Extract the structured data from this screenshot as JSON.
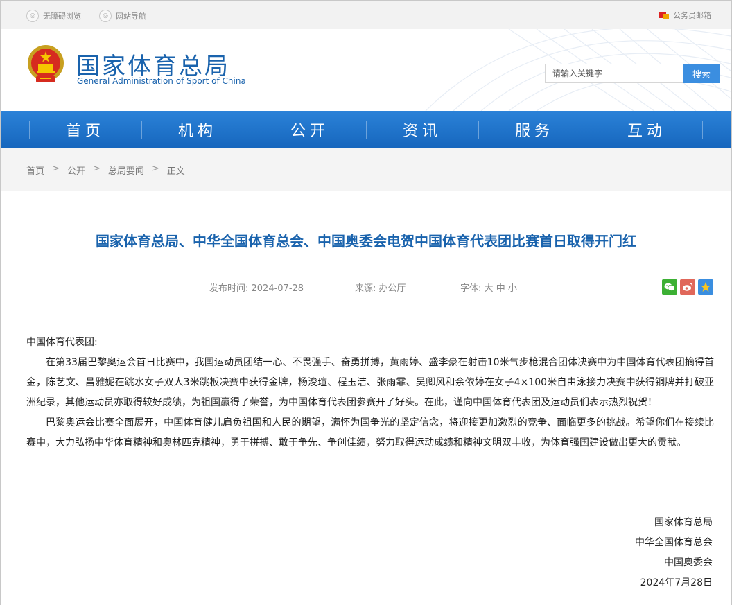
{
  "topbar": {
    "accessible": "无障碍浏览",
    "sitenav": "网站导航",
    "mail": "公务员邮箱"
  },
  "header": {
    "brand_cn": "国家体育总局",
    "brand_en": "General Administration of Sport of China",
    "search_placeholder": "请输入关键字",
    "search_button": "搜索"
  },
  "nav": [
    "首页",
    "机构",
    "公开",
    "资讯",
    "服务",
    "互动"
  ],
  "breadcrumb": [
    "首页",
    "公开",
    "总局要闻",
    "正文"
  ],
  "breadcrumb_sep": ">",
  "article": {
    "title": "国家体育总局、中华全国体育总会、中国奥委会电贺中国体育代表团比赛首日取得开门红",
    "date_label": "发布时间: 2024-07-28",
    "source_label": "来源: 办公厅",
    "font_label": "字体:",
    "font_sizes": [
      "大",
      "中",
      "小"
    ],
    "salutation": "中国体育代表团:",
    "para1": "在第33届巴黎奥运会首日比赛中，我国运动员团结一心、不畏强手、奋勇拼搏，黄雨婷、盛李豪在射击10米气步枪混合团体决赛中为中国体育代表团摘得首金，陈艺文、昌雅妮在跳水女子双人3米跳板决赛中获得金牌，杨浚瑄、程玉洁、张雨霏、吴卿风和余依婷在女子4×100米自由泳接力决赛中获得铜牌并打破亚洲纪录，其他运动员亦取得较好成绩，为祖国赢得了荣誉，为中国体育代表团参赛开了好头。在此，谨向中国体育代表团及运动员们表示热烈祝贺！",
    "para2": "巴黎奥运会比赛全面展开，中国体育健儿肩负祖国和人民的期望，满怀为国争光的坚定信念，将迎接更加激烈的竞争、面临更多的挑战。希望你们在接续比赛中，大力弘扬中华体育精神和奥林匹克精神，勇于拼搏、敢于争先、争创佳绩，努力取得运动成绩和精神文明双丰收，为体育强国建设做出更大的贡献。",
    "signatures": [
      "国家体育总局",
      "中华全国体育总会",
      "中国奥委会",
      "2024年7月28日"
    ]
  },
  "colors": {
    "brand_blue": "#1a63ad",
    "nav_blue": "#1e72c8",
    "search_button": "#3b8ee0"
  }
}
